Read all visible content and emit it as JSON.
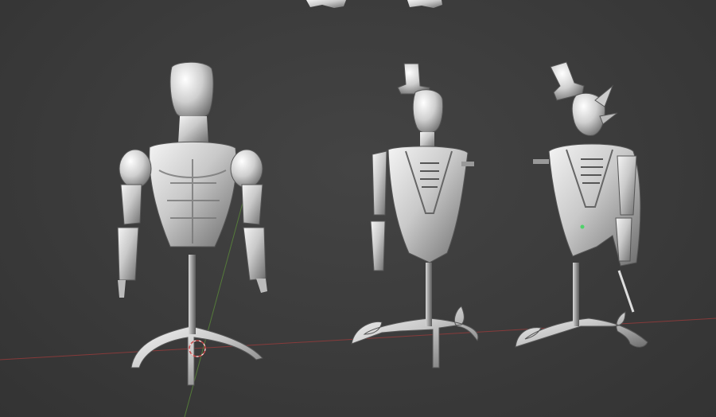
{
  "viewport": {
    "background_color": "#3d3d3d",
    "x_axis_color": "#9a3b3b",
    "y_axis_color": "#5b8a3a",
    "cursor_color": "#c84a4a"
  },
  "objects": [
    {
      "name": "mannequin-muscular",
      "material": "clay-white"
    },
    {
      "name": "mannequin-vest-tophat",
      "material": "clay-white"
    },
    {
      "name": "mannequin-tailcoat-tophat",
      "material": "clay-white"
    }
  ]
}
